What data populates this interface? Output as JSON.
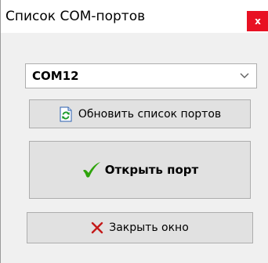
{
  "window": {
    "title": "Список COM-портов",
    "close_glyph": "x"
  },
  "port_select": {
    "value": "COM12",
    "chevron_icon": "chevron-down-icon"
  },
  "buttons": {
    "refresh": {
      "label": "Обновить список портов",
      "icon": "refresh-icon"
    },
    "open": {
      "label": "Открыть порт",
      "icon": "checkmark-icon"
    },
    "close_window": {
      "label": "Закрыть окно",
      "icon": "cross-icon"
    }
  },
  "colors": {
    "close_button_bg": "#e81123",
    "check_green": "#2ea40b",
    "cross_red": "#c41a1a",
    "refresh_green": "#1c9a2c",
    "refresh_blue": "#2a5fb0"
  }
}
